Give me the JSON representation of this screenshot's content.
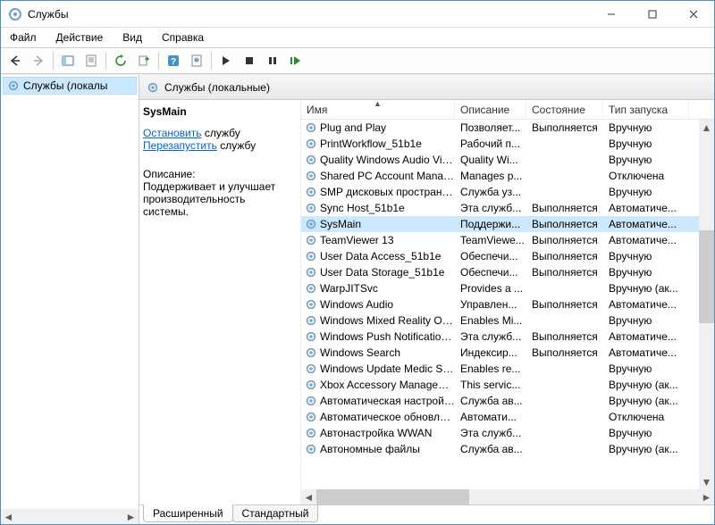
{
  "window": {
    "title": "Службы"
  },
  "menu": {
    "file": "Файл",
    "action": "Действие",
    "view": "Вид",
    "help": "Справка"
  },
  "tree": {
    "root": "Службы (локалы"
  },
  "header": {
    "title": "Службы (локальные)"
  },
  "detail": {
    "selected": "SysMain",
    "stop_link": "Остановить",
    "stop_suffix": " службу",
    "restart_link": "Перезапустить",
    "restart_suffix": " службу",
    "desc_label": "Описание:",
    "desc_text": "Поддерживает и улучшает производительность системы."
  },
  "columns": {
    "name": "Имя",
    "desc": "Описание",
    "state": "Состояние",
    "startup": "Тип запуска"
  },
  "services": [
    {
      "name": "Plug and Play",
      "desc": "Позволяет...",
      "state": "Выполняется",
      "startup": "Вручную",
      "sel": false
    },
    {
      "name": "PrintWorkflow_51b1e",
      "desc": "Рабочий п...",
      "state": "",
      "startup": "Вручную",
      "sel": false
    },
    {
      "name": "Quality Windows Audio Vid...",
      "desc": "Quality Wi...",
      "state": "",
      "startup": "Вручную",
      "sel": false
    },
    {
      "name": "Shared PC Account Manager",
      "desc": "Manages p...",
      "state": "",
      "startup": "Отключена",
      "sel": false
    },
    {
      "name": "SMP дисковых пространст...",
      "desc": "Служба уз...",
      "state": "",
      "startup": "Вручную",
      "sel": false
    },
    {
      "name": "Sync Host_51b1e",
      "desc": "Эта служб...",
      "state": "Выполняется",
      "startup": "Автоматиче...",
      "sel": false
    },
    {
      "name": "SysMain",
      "desc": "Поддержи...",
      "state": "Выполняется",
      "startup": "Автоматиче...",
      "sel": true
    },
    {
      "name": "TeamViewer 13",
      "desc": "TeamViewe...",
      "state": "Выполняется",
      "startup": "Автоматиче...",
      "sel": false
    },
    {
      "name": "User Data Access_51b1e",
      "desc": "Обеспечи...",
      "state": "Выполняется",
      "startup": "Вручную",
      "sel": false
    },
    {
      "name": "User Data Storage_51b1e",
      "desc": "Обеспечи...",
      "state": "Выполняется",
      "startup": "Вручную",
      "sel": false
    },
    {
      "name": "WarpJITSvc",
      "desc": "Provides a ...",
      "state": "",
      "startup": "Вручную (ак...",
      "sel": false
    },
    {
      "name": "Windows Audio",
      "desc": "Управлен...",
      "state": "Выполняется",
      "startup": "Автоматиче...",
      "sel": false
    },
    {
      "name": "Windows Mixed Reality Op...",
      "desc": "Enables Mi...",
      "state": "",
      "startup": "Вручную",
      "sel": false
    },
    {
      "name": "Windows Push Notification...",
      "desc": "Эта служб...",
      "state": "Выполняется",
      "startup": "Автоматиче...",
      "sel": false
    },
    {
      "name": "Windows Search",
      "desc": "Индексир...",
      "state": "Выполняется",
      "startup": "Автоматиче...",
      "sel": false
    },
    {
      "name": "Windows Update Medic Ser...",
      "desc": "Enables re...",
      "state": "",
      "startup": "Вручную",
      "sel": false
    },
    {
      "name": "Xbox Accessory Manageme...",
      "desc": "This servic...",
      "state": "",
      "startup": "Вручную (ак...",
      "sel": false
    },
    {
      "name": "Автоматическая настройк...",
      "desc": "Служба ав...",
      "state": "",
      "startup": "Вручную (ак...",
      "sel": false
    },
    {
      "name": "Автоматическое обновлен...",
      "desc": "Автомати...",
      "state": "",
      "startup": "Отключена",
      "sel": false
    },
    {
      "name": "Автонастройка WWAN",
      "desc": "Эта служб...",
      "state": "",
      "startup": "Вручную",
      "sel": false
    },
    {
      "name": "Автономные файлы",
      "desc": "Служба ав...",
      "state": "",
      "startup": "Вручную (ак...",
      "sel": false
    }
  ],
  "tabs": {
    "extended": "Расширенный",
    "standard": "Стандартный"
  }
}
